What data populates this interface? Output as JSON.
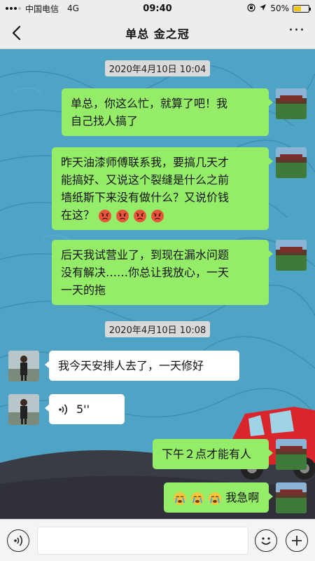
{
  "status_bar": {
    "carrier": "中国电信",
    "network": "4G",
    "time": "09:40",
    "battery_percent": "50%",
    "battery_level": 0.5
  },
  "nav": {
    "title": "单总  金之冠",
    "more_label": "···"
  },
  "timestamps": [
    "2020年4月10日 10:04",
    "2020年4月10日 10:08"
  ],
  "messages": [
    {
      "sender": "me",
      "lines": [
        "单总，你这么忙，就算了吧！我",
        "自己找人搞了"
      ]
    },
    {
      "sender": "me",
      "lines": [
        "昨天油漆师傅联系我，要搞几天才",
        "能搞好、又说这个裂缝是什么之前",
        "墙纸斯下来没有做什么？又说价钱",
        "在这？"
      ],
      "emoji": [
        "angry-face-emoji",
        "angry-face-emoji",
        "angry-face-emoji",
        "angry-face-emoji"
      ]
    },
    {
      "sender": "me",
      "lines": [
        "后天我试营业了，到现在漏水问题",
        "没有解决……你总让我放心，一天",
        "一天的拖"
      ]
    },
    {
      "sender": "them",
      "lines": [
        "我今天安排人去了，一天修好"
      ]
    },
    {
      "sender": "them",
      "type": "voice",
      "duration": "5''"
    },
    {
      "sender": "me",
      "lines": [
        "下午２点才能有人"
      ]
    },
    {
      "sender": "me",
      "lines": [
        "我急啊"
      ],
      "emoji_before": [
        "crying-face-emoji",
        "crying-face-emoji",
        "crying-face-emoji"
      ]
    }
  ],
  "colors": {
    "my_bubble": "#95ec69",
    "their_bubble": "#ffffff",
    "chat_background": "#4fa3c4",
    "bars": "#ededed"
  }
}
